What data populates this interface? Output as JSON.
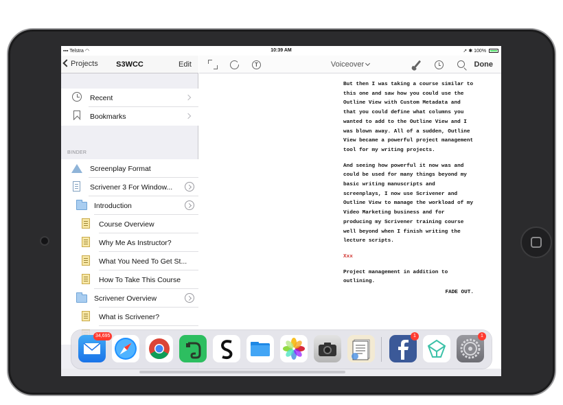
{
  "status_bar": {
    "carrier": "Telstra",
    "time": "10:39 AM",
    "battery": "100%"
  },
  "binder_nav": {
    "back_label": "Projects",
    "title": "S3WCC",
    "edit_label": "Edit"
  },
  "top_rows": [
    {
      "label": "Recent",
      "icon": "clock-icon"
    },
    {
      "label": "Bookmarks",
      "icon": "bookmark-icon"
    }
  ],
  "binder_header": "BINDER",
  "binder_items": [
    {
      "label": "Screenplay Format",
      "icon": "warning-icon"
    },
    {
      "label": "Scrivener 3 For Window...",
      "icon": "document-icon"
    },
    {
      "label": "Introduction",
      "icon": "folder-icon"
    },
    {
      "label": "Course Overview",
      "icon": "note-icon"
    },
    {
      "label": "Why Me As Instructor?",
      "icon": "note-icon"
    },
    {
      "label": "What You Need To Get St...",
      "icon": "note-icon"
    },
    {
      "label": "How To Take This Course",
      "icon": "note-icon"
    },
    {
      "label": "Scrivener Overview",
      "icon": "folder-icon"
    },
    {
      "label": "What is Scrivener?",
      "icon": "note-icon"
    }
  ],
  "editor_toolbar": {
    "doc_title": "Voiceover",
    "done_label": "Done"
  },
  "script": {
    "p1": "But then I was taking a course similar to this one and saw how you could use the Outline View with Custom Metadata and that you could define what columns you wanted to add to the Outline View and I was blown away. All of a sudden, Outline View became a powerful project management tool for my writing projects.",
    "p2": "And seeing how powerful it now was and could be used for many things beyond my basic writing manuscripts and screenplays, I now use Scrivener and Outline View to manage the workload of my Video Marketing business and for producing my Scrivener training course well beyond when I finish writing the lecture scripts.",
    "marker": "Xxx",
    "p3": "Project management in addition to outlining.",
    "transition": "FADE OUT."
  },
  "dock": {
    "apps": [
      {
        "name": "mail",
        "badge": "34,695"
      },
      {
        "name": "safari",
        "badge": ""
      },
      {
        "name": "chrome",
        "badge": ""
      },
      {
        "name": "evernote",
        "badge": ""
      },
      {
        "name": "scrivener",
        "badge": ""
      },
      {
        "name": "files",
        "badge": ""
      },
      {
        "name": "photos",
        "badge": ""
      },
      {
        "name": "camera",
        "badge": ""
      },
      {
        "name": "notes-app",
        "badge": ""
      },
      {
        "name": "facebook",
        "badge": "1"
      },
      {
        "name": "green-app",
        "badge": ""
      },
      {
        "name": "settings",
        "badge": "1"
      }
    ]
  },
  "colors": {
    "accent": "#007aff",
    "badge": "#ff3b30",
    "marker_red": "#d0312d"
  }
}
